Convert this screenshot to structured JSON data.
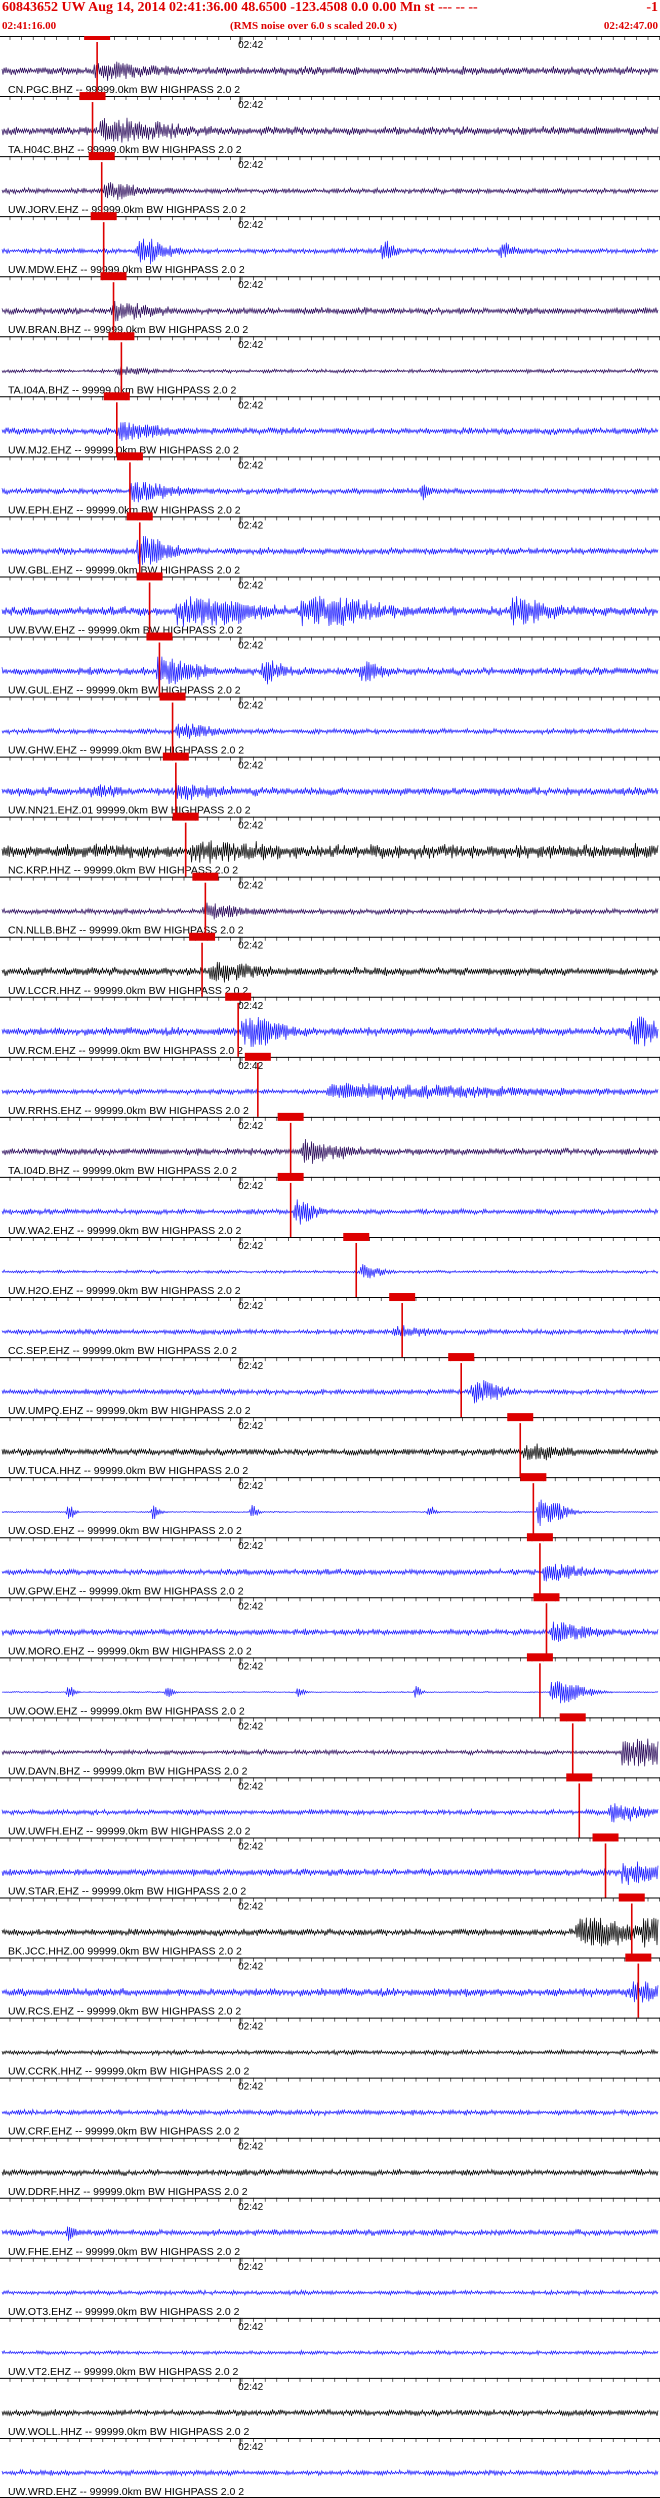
{
  "header": {
    "title": "60843652 UW Aug 14, 2014 02:41:36.00   48.6500 -123.4508  0.0 0.00 Mn st --- -- --",
    "code": "-1",
    "start_time": "02:41:16.00",
    "note": "(RMS noise over 6.0 s scaled 20.0 x)",
    "end_time": "02:42:47.00"
  },
  "colors": {
    "text": "#dd0000",
    "blue": "#1a1aff",
    "purple": "#2a0a5a",
    "black": "#000000",
    "pick": "#dd0000"
  },
  "chart_data": {
    "type": "line",
    "title": "60843652 UW Aug 14, 2014 02:41:36.00   48.6500 -123.4508  0.0 0.00 Mn st --- -- --",
    "x_range": [
      "02:41:16.00",
      "02:42:47.00"
    ],
    "tick_label": "02:42",
    "traces": [
      {
        "label": "CN.PGC.BHZ -- 99999.0km BW  HIGHPASS  2.0  2",
        "color": "purple",
        "pick": 0.145,
        "amp": 0.55,
        "bursts": [
          [
            0.145,
            1.0,
            8
          ]
        ]
      },
      {
        "label": "TA.H04C.BHZ -- 99999.0km BW  HIGHPASS  2.0  2",
        "color": "purple",
        "pick": 0.138,
        "amp": 0.55,
        "bursts": [
          [
            0.155,
            1.8,
            10
          ]
        ]
      },
      {
        "label": "UW.JORV.EHZ -- 99999.0km BW  HIGHPASS  2.0  2",
        "color": "purple",
        "pick": 0.152,
        "amp": 0.35,
        "bursts": [
          [
            0.16,
            1.2,
            6
          ]
        ]
      },
      {
        "label": "UW.MDW.EHZ -- 99999.0km BW  HIGHPASS  2.0  2",
        "color": "blue",
        "pick": 0.155,
        "amp": 0.35,
        "bursts": [
          [
            0.21,
            2.2,
            4
          ],
          [
            0.58,
            1.6,
            2
          ],
          [
            0.76,
            1.2,
            2
          ]
        ]
      },
      {
        "label": "UW.BRAN.BHZ -- 99999.0km BW  HIGHPASS  2.0  2",
        "color": "purple",
        "pick": 0.17,
        "amp": 0.45,
        "bursts": [
          [
            0.17,
            1.3,
            6
          ]
        ]
      },
      {
        "label": "TA.I04A.BHZ -- 99999.0km BW  HIGHPASS  2.0  2",
        "color": "purple",
        "pick": 0.182,
        "amp": 0.25,
        "bursts": [
          [
            0.18,
            0.6,
            4
          ]
        ]
      },
      {
        "label": "UW.MJ2.EHZ -- 99999.0km BW  HIGHPASS  2.0  2",
        "color": "blue",
        "pick": 0.175,
        "amp": 0.45,
        "bursts": [
          [
            0.18,
            1.2,
            6
          ]
        ]
      },
      {
        "label": "UW.EPH.EHZ -- 99999.0km BW  HIGHPASS  2.0  2",
        "color": "blue",
        "pick": 0.195,
        "amp": 0.4,
        "bursts": [
          [
            0.2,
            1.4,
            6
          ],
          [
            0.64,
            1.4,
            1
          ]
        ]
      },
      {
        "label": "UW.GBL.EHZ -- 99999.0km BW  HIGHPASS  2.0  2",
        "color": "blue",
        "pick": 0.21,
        "amp": 0.45,
        "bursts": [
          [
            0.21,
            2.2,
            5
          ]
        ]
      },
      {
        "label": "UW.BVW.EHZ -- 99999.0km BW  HIGHPASS  2.0  2",
        "color": "blue",
        "pick": 0.225,
        "amp": 0.6,
        "bursts": [
          [
            0.27,
            3.0,
            10
          ],
          [
            0.46,
            2.6,
            10
          ],
          [
            0.78,
            1.8,
            6
          ]
        ]
      },
      {
        "label": "UW.GUL.EHZ -- 99999.0km BW  HIGHPASS  2.0  2",
        "color": "blue",
        "pick": 0.24,
        "amp": 0.5,
        "bursts": [
          [
            0.24,
            2.4,
            6
          ],
          [
            0.4,
            1.6,
            3
          ],
          [
            0.55,
            1.4,
            3
          ]
        ]
      },
      {
        "label": "UW.GHW.EHZ -- 99999.0km BW  HIGHPASS  2.0  2",
        "color": "blue",
        "pick": 0.26,
        "amp": 0.35,
        "bursts": [
          [
            0.27,
            1.0,
            6
          ]
        ]
      },
      {
        "label": "UW.NN21.EHZ.01 99999.0km BW  HIGHPASS  2.0  2",
        "color": "blue",
        "pick": 0.265,
        "amp": 0.55,
        "bursts": [
          [
            0.27,
            1.0,
            6
          ],
          [
            0.14,
            0.7,
            3
          ]
        ]
      },
      {
        "label": "NC.KRP.HHZ -- 99999.0km BW  HIGHPASS  2.0  2",
        "color": "black",
        "pick": 0.28,
        "amp": 0.95,
        "bursts": [
          [
            0.29,
            1.0,
            10
          ]
        ]
      },
      {
        "label": "CN.NLLB.BHZ -- 99999.0km BW  HIGHPASS  2.0  2",
        "color": "purple",
        "pick": 0.31,
        "amp": 0.35,
        "bursts": [
          [
            0.31,
            1.0,
            6
          ]
        ]
      },
      {
        "label": "UW.LCCR.HHZ -- 99999.0km BW  HIGHPASS  2.0  2",
        "color": "black",
        "pick": 0.305,
        "amp": 0.55,
        "bursts": [
          [
            0.32,
            1.4,
            6
          ]
        ]
      },
      {
        "label": "UW.RCM.EHZ -- 99999.0km BW  HIGHPASS  2.0  2",
        "color": "blue",
        "pick": 0.36,
        "amp": 0.55,
        "bursts": [
          [
            0.37,
            2.4,
            6
          ],
          [
            0.96,
            3.0,
            4
          ]
        ]
      },
      {
        "label": "UW.RRHS.EHZ -- 99999.0km BW  HIGHPASS  2.0  2",
        "color": "blue",
        "pick": 0.39,
        "amp": 0.35,
        "bursts": [
          [
            0.5,
            1.0,
            30
          ]
        ]
      },
      {
        "label": "TA.I04D.BHZ -- 99999.0km BW  HIGHPASS  2.0  2",
        "color": "purple",
        "pick": 0.44,
        "amp": 0.45,
        "bursts": [
          [
            0.46,
            1.8,
            6
          ]
        ]
      },
      {
        "label": "UW.WA2.EHZ -- 99999.0km BW  HIGHPASS  2.0  2",
        "color": "blue",
        "pick": 0.44,
        "amp": 0.35,
        "bursts": [
          [
            0.45,
            1.8,
            3
          ]
        ]
      },
      {
        "label": "UW.H2O.EHZ -- 99999.0km BW  HIGHPASS  2.0  2",
        "color": "blue",
        "pick": 0.54,
        "amp": 0.2,
        "bursts": [
          [
            0.55,
            1.0,
            3
          ]
        ]
      },
      {
        "label": "CC.SEP.EHZ -- 99999.0km BW  HIGHPASS  2.0  2",
        "color": "blue",
        "pick": 0.61,
        "amp": 0.35,
        "bursts": [
          [
            0.6,
            0.8,
            5
          ]
        ]
      },
      {
        "label": "UW.UMPQ.EHZ -- 99999.0km BW  HIGHPASS  2.0  2",
        "color": "blue",
        "pick": 0.7,
        "amp": 0.35,
        "bursts": [
          [
            0.72,
            1.8,
            4
          ]
        ]
      },
      {
        "label": "UW.TUCA.HHZ -- 99999.0km BW  HIGHPASS  2.0  2",
        "color": "black",
        "pick": 0.79,
        "amp": 0.45,
        "bursts": [
          [
            0.8,
            1.2,
            5
          ]
        ]
      },
      {
        "label": "UW.OSD.EHZ -- 99999.0km BW  HIGHPASS  2.0  2",
        "color": "blue",
        "pick": 0.81,
        "amp": 0.08,
        "bursts": [
          [
            0.82,
            2.4,
            4
          ],
          [
            0.1,
            1.6,
            1
          ],
          [
            0.23,
            1.6,
            1
          ],
          [
            0.38,
            1.2,
            1
          ],
          [
            0.65,
            1.2,
            1
          ]
        ]
      },
      {
        "label": "UW.GPW.EHZ -- 99999.0km BW  HIGHPASS  2.0  2",
        "color": "blue",
        "pick": 0.82,
        "amp": 0.4,
        "bursts": [
          [
            0.83,
            1.2,
            5
          ]
        ]
      },
      {
        "label": "UW.MORO.EHZ -- 99999.0km BW  HIGHPASS  2.0  2",
        "color": "blue",
        "pick": 0.83,
        "amp": 0.4,
        "bursts": [
          [
            0.84,
            1.3,
            6
          ]
        ]
      },
      {
        "label": "UW.OOW.EHZ -- 99999.0km BW  HIGHPASS  2.0  2",
        "color": "blue",
        "pick": 0.82,
        "amp": 0.08,
        "bursts": [
          [
            0.84,
            2.0,
            5
          ],
          [
            0.1,
            1.2,
            1
          ],
          [
            0.25,
            1.2,
            1
          ],
          [
            0.45,
            1.0,
            1
          ],
          [
            0.63,
            1.0,
            1
          ]
        ]
      },
      {
        "label": "UW.DAVN.BHZ -- 99999.0km BW  HIGHPASS  2.0  2",
        "color": "purple",
        "pick": 0.87,
        "amp": 0.3,
        "bursts": [
          [
            0.95,
            3.2,
            8
          ]
        ]
      },
      {
        "label": "UW.UWFH.EHZ -- 99999.0km BW  HIGHPASS  2.0  2",
        "color": "blue",
        "pick": 0.88,
        "amp": 0.35,
        "bursts": [
          [
            0.93,
            1.4,
            5
          ]
        ]
      },
      {
        "label": "UW.STAR.EHZ -- 99999.0km BW  HIGHPASS  2.0  2",
        "color": "blue",
        "pick": 0.92,
        "amp": 0.45,
        "bursts": [
          [
            0.95,
            1.8,
            6
          ]
        ]
      },
      {
        "label": "BK.JCC.HHZ.00 99999.0km BW  HIGHPASS  2.0  2",
        "color": "black",
        "pick": 0.96,
        "amp": 0.45,
        "bursts": [
          [
            0.88,
            3.0,
            8
          ],
          [
            0.98,
            3.2,
            3
          ]
        ]
      },
      {
        "label": "UW.RCS.EHZ -- 99999.0km BW  HIGHPASS  2.0  2",
        "color": "blue",
        "pick": 0.97,
        "amp": 0.55,
        "bursts": [
          [
            0.96,
            1.4,
            6
          ]
        ]
      },
      {
        "label": "UW.CCRK.HHZ -- 99999.0km BW  HIGHPASS  2.0  2",
        "color": "black",
        "pick": null,
        "amp": 0.3,
        "bursts": []
      },
      {
        "label": "UW.CRF.EHZ -- 99999.0km BW  HIGHPASS  2.0  2",
        "color": "blue",
        "pick": null,
        "amp": 0.35,
        "bursts": []
      },
      {
        "label": "UW.DDRF.HHZ -- 99999.0km BW  HIGHPASS  2.0  2",
        "color": "black",
        "pick": null,
        "amp": 0.4,
        "bursts": []
      },
      {
        "label": "UW.FHE.EHZ -- 99999.0km BW  HIGHPASS  2.0  2",
        "color": "blue",
        "pick": null,
        "amp": 0.4,
        "bursts": [
          [
            0.1,
            1.4,
            1
          ]
        ]
      },
      {
        "label": "UW.OT3.EHZ -- 99999.0km BW  HIGHPASS  2.0  2",
        "color": "blue",
        "pick": null,
        "amp": 0.3,
        "bursts": []
      },
      {
        "label": "UW.VT2.EHZ -- 99999.0km BW  HIGHPASS  2.0  2",
        "color": "blue",
        "pick": null,
        "amp": 0.25,
        "bursts": []
      },
      {
        "label": "UW.WOLL.HHZ -- 99999.0km BW  HIGHPASS  2.0  2",
        "color": "black",
        "pick": null,
        "amp": 0.4,
        "bursts": []
      },
      {
        "label": "UW.WRD.EHZ -- 99999.0km BW  HIGHPASS  2.0  2",
        "color": "blue",
        "pick": null,
        "amp": 0.35,
        "bursts": []
      }
    ]
  }
}
